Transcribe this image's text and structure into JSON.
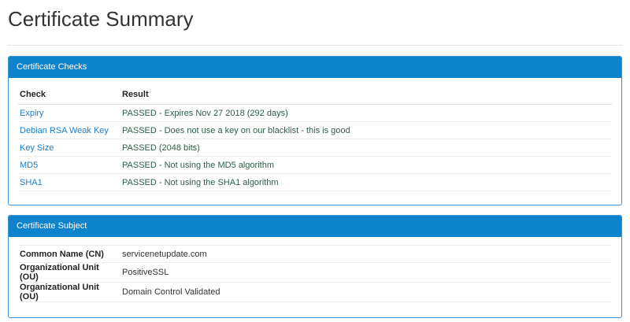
{
  "page": {
    "title": "Certificate Summary"
  },
  "checks_panel": {
    "heading": "Certificate Checks",
    "columns": [
      "Check",
      "Result"
    ],
    "rows": [
      {
        "check": "Expiry",
        "result": "PASSED - Expires Nov 27 2018 (292 days)"
      },
      {
        "check": "Debian RSA Weak Key",
        "result": "PASSED - Does not use a key on our blacklist - this is good"
      },
      {
        "check": "Key Size",
        "result": "PASSED (2048 bits)"
      },
      {
        "check": "MD5",
        "result": "PASSED - Not using the MD5 algorithm"
      },
      {
        "check": "SHA1",
        "result": "PASSED - Not using the SHA1 algorithm"
      }
    ]
  },
  "subject_panel": {
    "heading": "Certificate Subject",
    "rows": [
      {
        "label": "Common Name (CN)",
        "value": "servicenetupdate.com"
      },
      {
        "label": "Organizational Unit (OU)",
        "value": "PositiveSSL"
      },
      {
        "label": "Organizational Unit (OU)",
        "value": "Domain Control Validated"
      }
    ]
  },
  "colors": {
    "panel_heading": "#0e83cd",
    "link": "#1a7ec8",
    "result": "#2e5e47"
  }
}
